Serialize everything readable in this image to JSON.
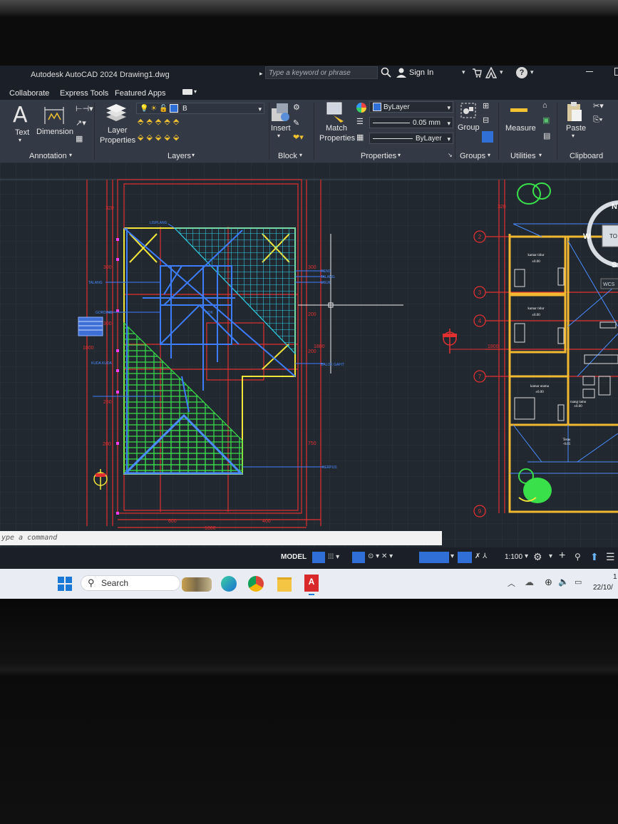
{
  "titlebar": {
    "app_name": "Autodesk AutoCAD 2024",
    "file_name": "Drawing1.dwg",
    "search_placeholder": "Type a keyword or phrase",
    "sign_in": "Sign In"
  },
  "menubar": {
    "tabs": [
      "Collaborate",
      "Express Tools",
      "Featured Apps"
    ]
  },
  "ribbon": {
    "annotation": {
      "text": "Text",
      "dimension": "Dimension",
      "panel": "Annotation"
    },
    "layers": {
      "layer_properties_line1": "Layer",
      "layer_properties_line2": "Properties",
      "current_layer": "B",
      "panel": "Layers"
    },
    "block": {
      "insert": "Insert",
      "panel": "Block"
    },
    "properties": {
      "match_line1": "Match",
      "match_line2": "Properties",
      "color": "ByLayer",
      "lineweight": "0.05 mm",
      "linetype": "ByLayer",
      "panel": "Properties"
    },
    "groups": {
      "group": "Group",
      "panel": "Groups"
    },
    "utilities": {
      "measure": "Measure",
      "panel": "Utilities"
    },
    "clipboard": {
      "paste": "Paste",
      "panel": "Clipboard"
    },
    "colors": {
      "accent_blue": "#2f6fd6",
      "background": "#343a45"
    }
  },
  "drawing": {
    "dims_left": [
      "320",
      "300",
      "300",
      "1800",
      "250",
      "200"
    ],
    "dims_right": [
      "300",
      "200",
      "200",
      "1800",
      "750"
    ],
    "dims_bottom": [
      "600",
      "400",
      "1000"
    ],
    "labels_left": [
      "TALANG",
      "GORDING",
      "KUDA KUDA",
      "NOK",
      "LISPLANG"
    ],
    "labels_right": [
      "RENG",
      "TALANG",
      "USUK",
      "BALOK GAPIT",
      "KERPUS"
    ],
    "grid_bubbles": [
      "2",
      "3",
      "4",
      "7",
      "9"
    ],
    "right_dim": "1800",
    "rooms": [
      {
        "name": "kamar tidur",
        "level": "±0.00"
      },
      {
        "name": "kamar tidur",
        "level": "±0.00"
      },
      {
        "name": "kamar utama",
        "level": "±0.00"
      },
      {
        "name": "ruang tamu",
        "level": "±0.00"
      },
      {
        "name": "Teras",
        "level": "-0.05"
      }
    ],
    "viewcube": {
      "west": "W",
      "south": "S",
      "top": "TO",
      "north": "N",
      "wcs": "WCS"
    }
  },
  "command_line": {
    "placeholder": "ype a command"
  },
  "statusbar": {
    "model": "MODEL",
    "scale": "1:100"
  },
  "taskbar": {
    "search": "Search",
    "date": "22/10/",
    "time": "1"
  }
}
